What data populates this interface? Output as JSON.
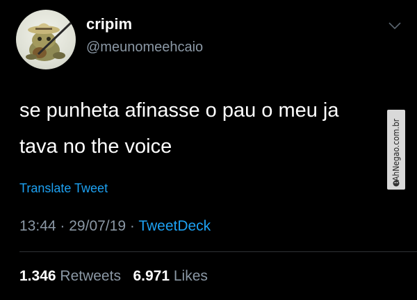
{
  "user": {
    "display_name": "cripim",
    "handle": "@meunomeehcaio"
  },
  "tweet": {
    "text": "se punheta afinasse o pau o meu ja\ntava no the voice",
    "translate_label": "Translate Tweet",
    "time": "13:44",
    "date": "29/07/19",
    "separator": "·",
    "source": "TweetDeck"
  },
  "stats": {
    "retweets_count": "1.346",
    "retweets_label": "Retweets",
    "likes_count": "6.971",
    "likes_label": "Likes"
  },
  "watermark": {
    "text": "AhNegao.com.br"
  },
  "colors": {
    "background": "#000000",
    "text": "#ffffff",
    "muted": "#8b98a5",
    "accent": "#1da1f2"
  },
  "icons": {
    "menu": "chevron-down-icon",
    "watermark_logo": "logo-icon"
  }
}
